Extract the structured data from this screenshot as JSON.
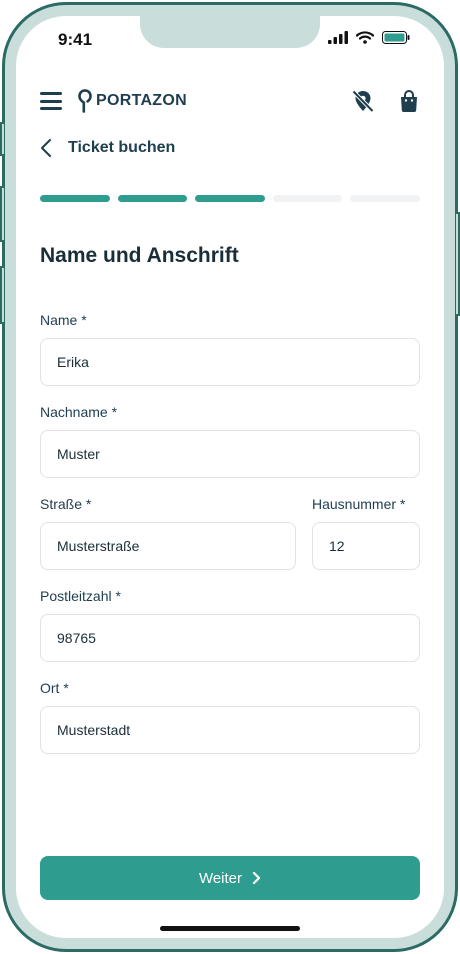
{
  "status": {
    "time": "9:41"
  },
  "header": {
    "logo_text": "PORTAZON"
  },
  "back": {
    "label": "Ticket buchen"
  },
  "progress": {
    "total_steps": 5,
    "completed_steps": 3
  },
  "form": {
    "title": "Name und Anschrift",
    "name": {
      "label": "Name *",
      "value": "Erika"
    },
    "nachname": {
      "label": "Nachname *",
      "value": "Muster"
    },
    "strasse": {
      "label": "Straße *",
      "value": "Musterstraße"
    },
    "hausnummer": {
      "label": "Hausnummer *",
      "value": "12"
    },
    "plz": {
      "label": "Postleitzahl *",
      "value": "98765"
    },
    "ort": {
      "label": "Ort *",
      "value": "Musterstadt"
    }
  },
  "footer": {
    "next_label": "Weiter"
  },
  "colors": {
    "accent": "#2e9d8f",
    "text_dark": "#1f3e4e",
    "frame": "#2c6b64"
  },
  "icons": [
    "hamburger-icon",
    "location-pin-icon",
    "location-off-icon",
    "shopping-bag-icon",
    "chevron-left-icon",
    "chevron-right-icon",
    "signal-icon",
    "wifi-icon",
    "battery-icon"
  ]
}
